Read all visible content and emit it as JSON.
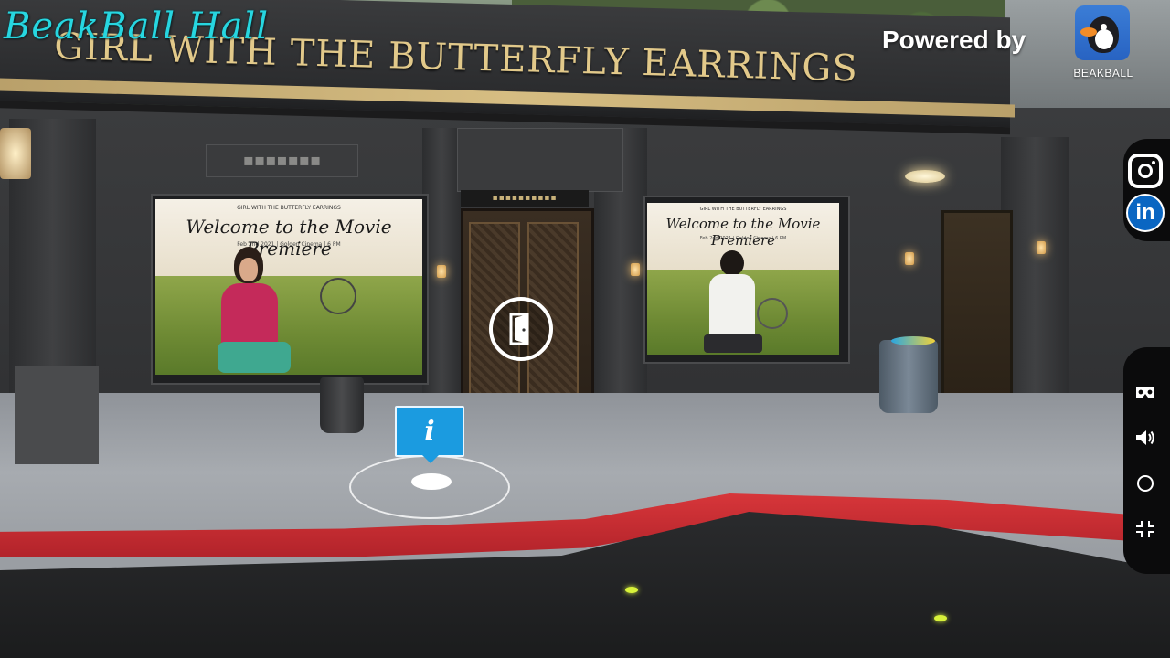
{
  "app": {
    "hall_title": "BeakBall Hall",
    "powered_by": "Powered by",
    "brand_name": "BEAKBALL",
    "icon": "beakball-logo"
  },
  "scene": {
    "marquee_text": "GIRL WITH THE BUTTERFLY EARRINGS",
    "posters": [
      {
        "small_top": "GIRL WITH THE BUTTERFLY EARRINGS",
        "title": "Welcome to the Movie Premiere",
        "subtitle": "Feb 2nd 2021 | Golden Cinema | 6 PM"
      },
      {
        "small_top": "GIRL WITH THE BUTTERFLY EARRINGS",
        "title": "Welcome to the Movie Premiere",
        "subtitle": "Feb 2nd 2021 | Golden Cinema | 6 PM"
      }
    ],
    "hotspots": {
      "door_icon": "door-icon",
      "info_letter": "i"
    }
  },
  "sidebar": {
    "social": [
      {
        "name": "instagram",
        "icon": "instagram-icon"
      },
      {
        "name": "linkedin",
        "icon": "linkedin-icon",
        "glyph": "in"
      }
    ],
    "controls": [
      {
        "name": "vr-mode",
        "icon": "vr-headset-icon"
      },
      {
        "name": "sound",
        "icon": "volume-icon"
      },
      {
        "name": "autorotate",
        "icon": "circle-icon"
      },
      {
        "name": "exit-fullscreen",
        "icon": "exit-fullscreen-icon"
      }
    ]
  },
  "colors": {
    "title_cyan": "#27d6e0",
    "info_blue": "#1b9be0",
    "carpet_red": "#c8282e",
    "linkedin_blue": "#0a66c2"
  }
}
